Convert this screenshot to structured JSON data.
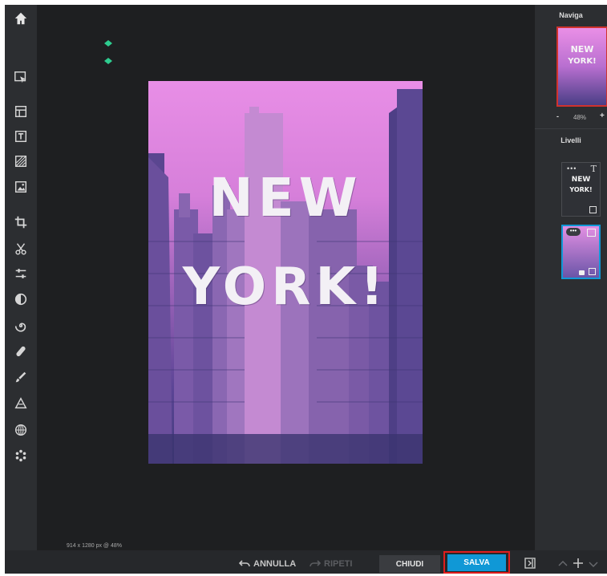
{
  "canvas": {
    "dimensions_label": "914 x 1280 px @ 48%",
    "headline_line1": "NEW",
    "headline_line2": "YORK!"
  },
  "toolbar": {
    "icons": [
      "home-icon",
      "arrange-icon",
      "layout-icon",
      "text-icon",
      "pattern-icon",
      "image-icon",
      "crop-icon",
      "cutout-icon",
      "adjust-icon",
      "filter-icon",
      "effect-icon",
      "retouch-icon",
      "draw-icon",
      "vector-icon",
      "frame-icon",
      "elements-icon",
      "settings-icon"
    ]
  },
  "bottom": {
    "undo_label": "ANNULLA",
    "redo_label": "RIPETI",
    "close_label": "CHIUDI",
    "save_label": "SALVA"
  },
  "navigator": {
    "title": "Naviga",
    "zoom_minus": "-",
    "zoom_value": "48%",
    "zoom_plus": "+"
  },
  "layers": {
    "title": "Livelli",
    "layer1_text_line1": "NEW",
    "layer1_text_line2": "YORK!"
  },
  "colors": {
    "accent": "#1098d6",
    "highlight": "#e11d1d",
    "handle": "#2ecc8f"
  }
}
